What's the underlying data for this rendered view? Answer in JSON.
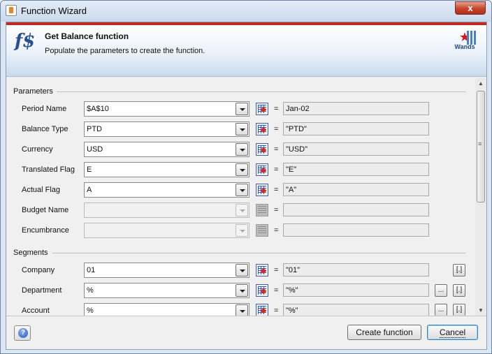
{
  "window": {
    "title": "Function Wizard",
    "close_label": "x"
  },
  "header": {
    "logo_text": "f$",
    "title": "Get Balance function",
    "subtitle": "Populate the parameters to create the function.",
    "brand_label": "Wands",
    "accent_color": "#c12a22"
  },
  "parameters": {
    "section_label": "Parameters",
    "rows": [
      {
        "label": "Period Name",
        "value": "$A$10",
        "equals": "=",
        "result": "Jan-02",
        "enabled": true
      },
      {
        "label": "Balance Type",
        "value": "PTD",
        "equals": "=",
        "result": "\"PTD\"",
        "enabled": true
      },
      {
        "label": "Currency",
        "value": "USD",
        "equals": "=",
        "result": "\"USD\"",
        "enabled": true
      },
      {
        "label": "Translated Flag",
        "value": "E",
        "equals": "=",
        "result": "\"E\"",
        "enabled": true
      },
      {
        "label": "Actual Flag",
        "value": "A",
        "equals": "=",
        "result": "\"A\"",
        "enabled": true
      },
      {
        "label": "Budget Name",
        "value": "",
        "equals": "=",
        "result": "",
        "enabled": false
      },
      {
        "label": "Encumbrance",
        "value": "",
        "equals": "=",
        "result": "",
        "enabled": false
      }
    ]
  },
  "segments": {
    "section_label": "Segments",
    "ellipsis_label": "...",
    "bracket_label": "[.]",
    "rows": [
      {
        "label": "Company",
        "value": "01",
        "equals": "=",
        "result": "\"01\""
      },
      {
        "label": "Department",
        "value": "%",
        "equals": "=",
        "result": "\"%\""
      },
      {
        "label": "Account",
        "value": "%",
        "equals": "=",
        "result": "\"%\""
      }
    ]
  },
  "footer": {
    "help_icon": "help-icon",
    "help_glyph": "?",
    "create_label": "Create function",
    "cancel_label": "Cancel"
  }
}
